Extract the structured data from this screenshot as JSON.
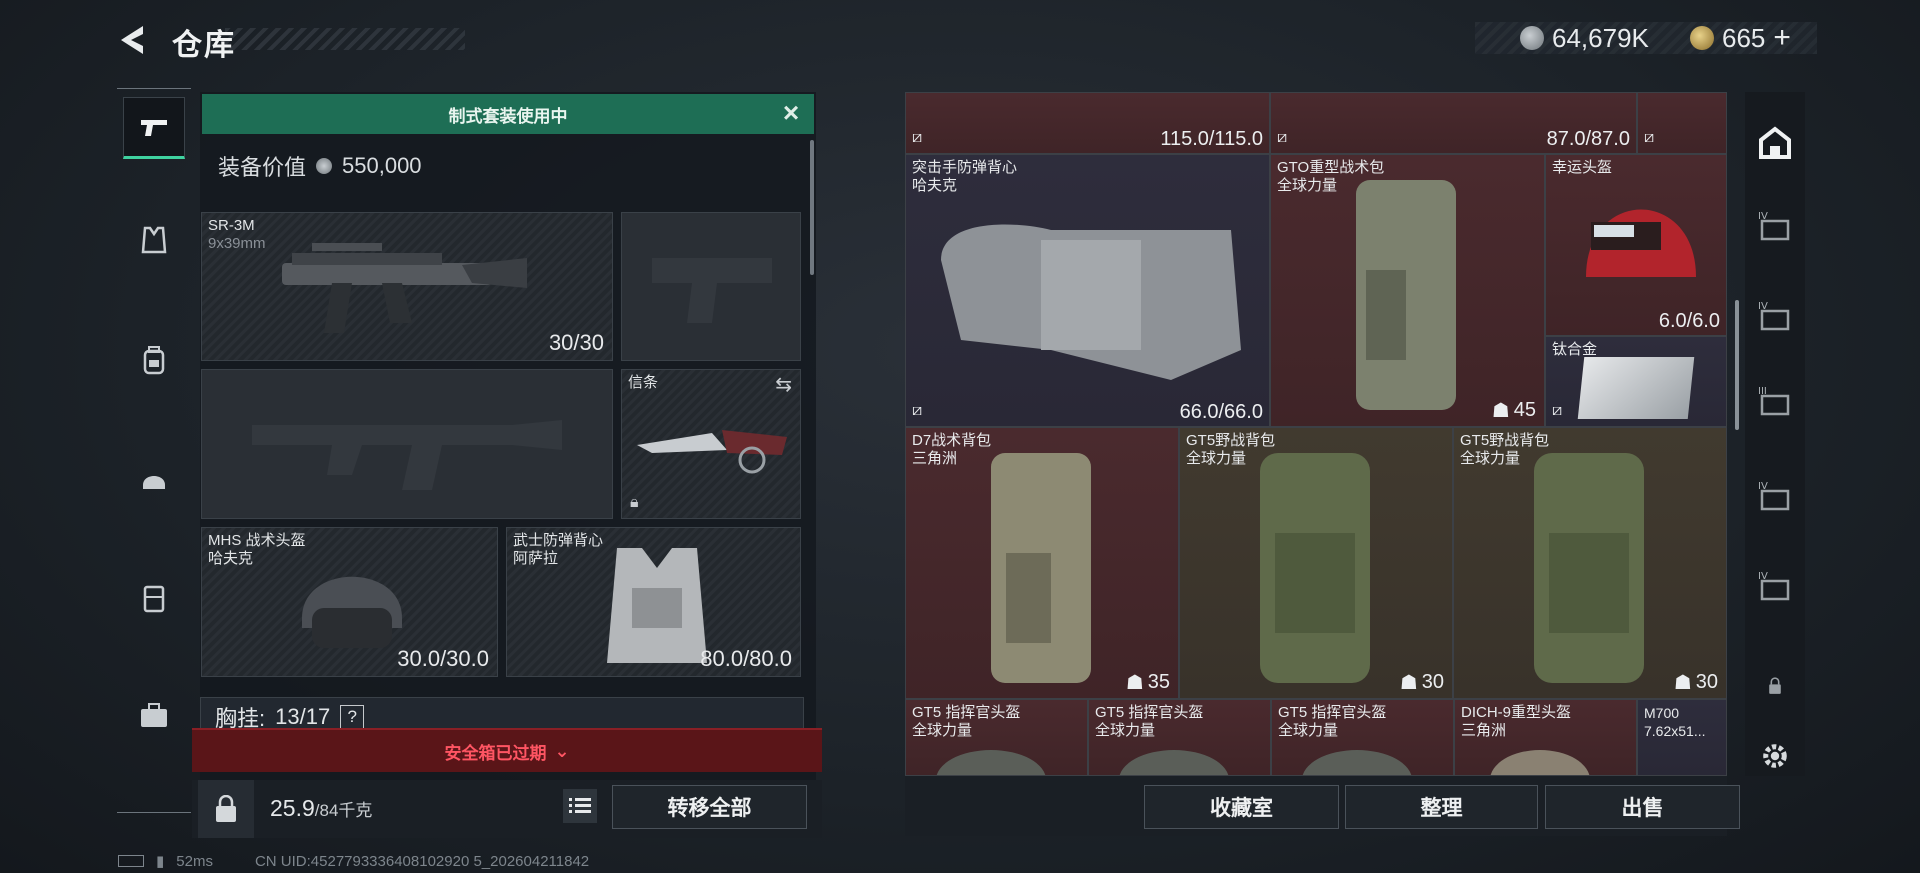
{
  "header": {
    "title": "仓库",
    "currency_silver": "64,679K",
    "currency_gold": "665"
  },
  "nav": [
    {
      "id": "weapons",
      "icon": "pistol-icon",
      "active": true
    },
    {
      "id": "armor",
      "icon": "vest-icon",
      "active": false
    },
    {
      "id": "backpack",
      "icon": "backpack-icon",
      "active": false
    },
    {
      "id": "helmet",
      "icon": "helmet-icon",
      "active": false
    },
    {
      "id": "chest_rig",
      "icon": "chest-rig-icon",
      "active": false
    },
    {
      "id": "case",
      "icon": "briefcase-icon",
      "active": false
    }
  ],
  "loadout": {
    "banner": "制式套装使用中",
    "value_label": "装备价值",
    "value": "550,000",
    "primary": {
      "name": "SR-3M",
      "sub": "9x39mm",
      "count": "30/30"
    },
    "melee": {
      "name": "信条"
    },
    "helmet": {
      "name": "MHS 战术头盔",
      "sub": "哈夫克",
      "count": "30.0/30.0"
    },
    "vest": {
      "name": "武士防弹背心",
      "sub": "阿萨拉",
      "count": "80.0/80.0"
    },
    "chest_label": "胸挂:",
    "chest_count": "13/17",
    "chest_help": "?",
    "safe_box": "安全箱已过期",
    "weight": "25.9",
    "weight_max": "/84千克",
    "transfer_all": "转移全部"
  },
  "grid": {
    "top_row": [
      "115.0/115.0",
      "87.0/87.0"
    ],
    "items": [
      {
        "name": "突击手防弹背心",
        "sub": "哈夫克",
        "value": "66.0/66.0"
      },
      {
        "name": "GTO重型战术包",
        "sub": "全球力量",
        "value": "45"
      },
      {
        "name": "幸运头盔",
        "sub": "",
        "value": "6.0/6.0"
      },
      {
        "name": "钛合金",
        "sub": "",
        "value": ""
      },
      {
        "name": "D7战术背包",
        "sub": "三角洲",
        "value": "35"
      },
      {
        "name": "GT5野战背包",
        "sub": "全球力量",
        "value": "30"
      },
      {
        "name": "GT5野战背包",
        "sub": "全球力量",
        "value": "30"
      },
      {
        "name": "GT5 指挥官头盔",
        "sub": "全球力量",
        "value": ""
      },
      {
        "name": "GT5 指挥官头盔",
        "sub": "全球力量",
        "value": ""
      },
      {
        "name": "GT5 指挥官头盔",
        "sub": "全球力量",
        "value": ""
      },
      {
        "name": "DICH-9重型头盔",
        "sub": "三角洲",
        "value": ""
      },
      {
        "name": "M700",
        "sub": "7.62x51...",
        "value": ""
      }
    ],
    "buttons": {
      "collection": "收藏室",
      "sort": "整理",
      "sell": "出售"
    }
  },
  "status": {
    "ping": "52ms",
    "uid": "CN UID:4527793336408102920 5_202604211842"
  }
}
